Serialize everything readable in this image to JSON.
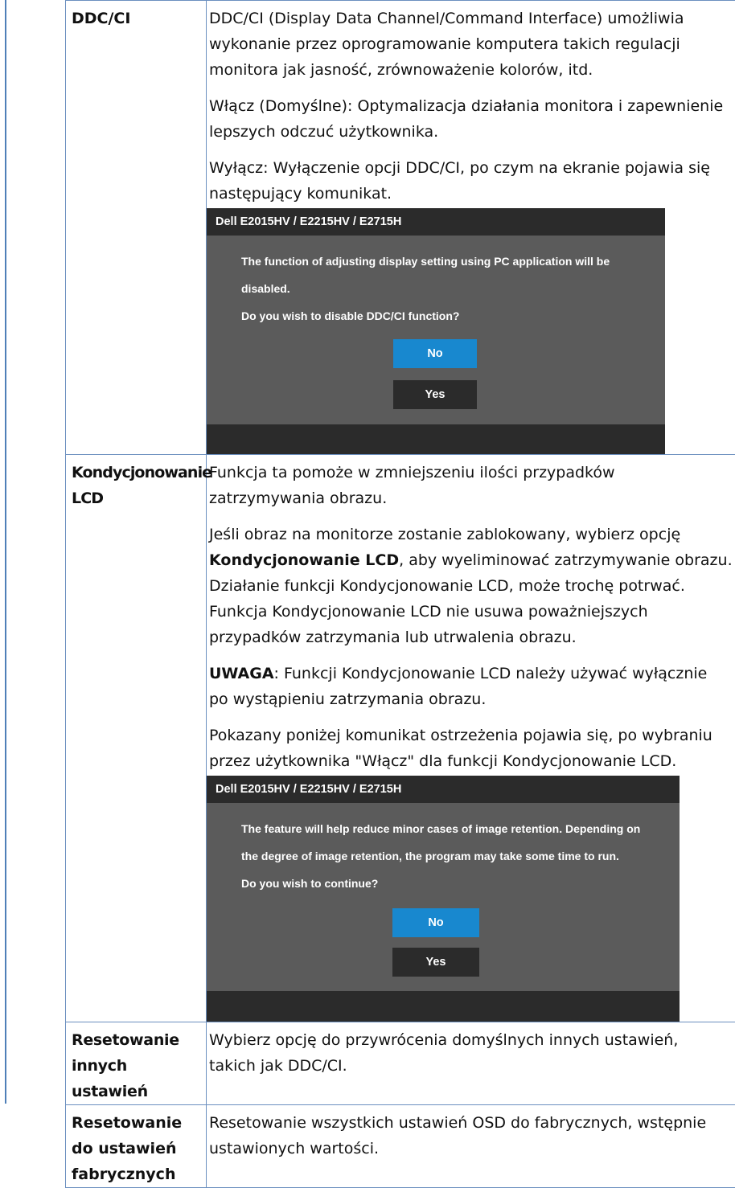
{
  "rows": [
    {
      "label_lines": [
        "DDC/CI"
      ],
      "paragraphs": [
        [
          "DDC/CI (Display Data Channel/Command Interface) umożliwia",
          "wykonanie przez oprogramowanie komputera takich regulacji",
          "monitora jak jasność, zrównoważenie kolorów, itd."
        ],
        [
          "Włącz (Domyślne): Optymalizacja działania monitora i zapewnienie",
          "lepszych odczuć użytkownika."
        ],
        [
          "Wyłącz: Wyłączenie opcji DDC/CI, po czym na ekranie pojawia się",
          "następujący komunikat."
        ]
      ],
      "dialog": {
        "title": "Dell E2015HV / E2215HV / E2715H",
        "lines": [
          "The function of adjusting display setting using PC application will be",
          "disabled.",
          "Do you wish to disable DDC/CI function?"
        ],
        "no_label": "No",
        "yes_label": "Yes"
      }
    },
    {
      "label_lines": [
        "Kondycjonowanie",
        "LCD"
      ],
      "p1": [
        "Funkcja ta pomoże w zmniejszeniu ilości przypadków",
        "zatrzymywania obrazu."
      ],
      "p2_line1": "Jeśli obraz na monitorze zostanie zablokowany, wybierz opcję",
      "p2_bold": "Kondycjonowanie LCD",
      "p2_line2_rest": ", aby wyeliminować zatrzymywanie obrazu.",
      "p2_rest": [
        "Działanie funkcji Kondycjonowanie LCD, może trochę potrwać.",
        "Funkcja Kondycjonowanie LCD nie usuwa poważniejszych",
        "przypadków zatrzymania lub utrwalenia obrazu."
      ],
      "note_label": "UWAGA",
      "note_line1_rest": ": Funkcji Kondycjonowanie LCD należy używać wyłącznie",
      "note_line2": "po wystąpieniu zatrzymania obrazu.",
      "p4": [
        "Pokazany poniżej komunikat ostrzeżenia pojawia się, po wybraniu",
        "przez użytkownika \"Włącz\" dla funkcji Kondycjonowanie LCD."
      ],
      "dialog": {
        "title": "Dell E2015HV / E2215HV / E2715H",
        "lines": [
          "The feature will help reduce minor cases of image retention. Depending on",
          "the degree of image retention, the program may take some time to run.",
          "Do you wish to continue?"
        ],
        "no_label": "No",
        "yes_label": "Yes"
      }
    },
    {
      "label_lines": [
        "Resetowanie",
        "innych ustawień"
      ],
      "lines": [
        "Wybierz opcję do przywrócenia domyślnych innych ustawień,",
        "takich jak DDC/CI."
      ]
    },
    {
      "label_lines": [
        "Resetowanie",
        "do ustawień",
        "fabrycznych"
      ],
      "lines": [
        "Resetowanie wszystkich ustawień OSD do fabrycznych, wstępnie",
        "ustawionych wartości."
      ]
    }
  ]
}
